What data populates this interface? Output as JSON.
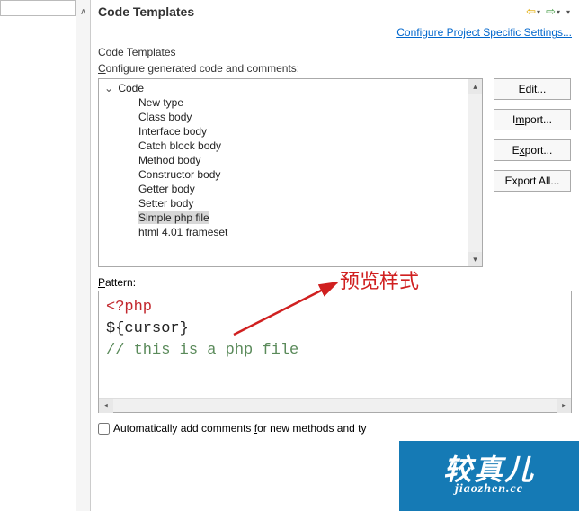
{
  "header": {
    "title": "Code Templates",
    "configureLink": "Configure Project Specific Settings..."
  },
  "labels": {
    "subTitle": "Code Templates",
    "configureGenerated": "Configure generated code and comments:",
    "pattern": "Pattern:",
    "autoComments": "Automatically add comments for new methods and ty"
  },
  "tree": {
    "root": "Code",
    "items": [
      "New type",
      "Class body",
      "Interface body",
      "Catch block body",
      "Method body",
      "Constructor body",
      "Getter body",
      "Setter body",
      "Simple php file",
      "html 4.01 frameset"
    ],
    "selectedIndex": 8
  },
  "buttons": {
    "edit": "Edit...",
    "import": "Import...",
    "export": "Export...",
    "exportAll": "Export All..."
  },
  "code": {
    "line1": "<?php",
    "line2": "${cursor}",
    "line3": "// this is a php file"
  },
  "annotation": "预览样式",
  "watermark": {
    "main": "较真儿",
    "sub": "jiaozhen.cc"
  }
}
